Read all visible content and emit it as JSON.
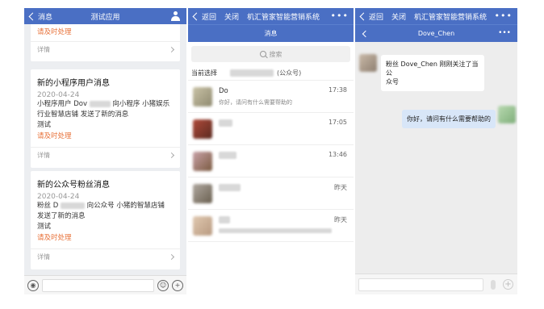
{
  "panel1": {
    "back_label": "消息",
    "title": "测试应用",
    "top_card": {
      "alert": "请及时处理",
      "detail_label": "详情"
    },
    "card1": {
      "title": "新的小程序用户消息",
      "date": "2020-04-24",
      "line1_pre": "小程序用户 Dov",
      "line1_post": "向小程序 小猪娱乐",
      "line2": "行业智慧店铺 发送了新的消息",
      "line3": "测试",
      "alert": "请及时处理",
      "detail_label": "详情"
    },
    "card2": {
      "title": "新的公众号粉丝消息",
      "date": "2020-04-24",
      "line1_pre": "粉丝 D",
      "line1_post": "向公众号 小猪的智慧店铺",
      "line2": "发送了新的消息",
      "line3": "测试",
      "alert": "请及时处理",
      "detail_label": "详情"
    }
  },
  "panel2": {
    "back_label": "返回",
    "close_label": "关闭",
    "title": "机汇管家智能营销系统",
    "more": "•••",
    "sub_title": "消息",
    "search_placeholder": "搜索",
    "current_label": "当前选择",
    "current_tag": "(公众号)",
    "conversations": [
      {
        "name": "Do",
        "msg": "你好，请问有什么需要帮助的",
        "time": "17:38"
      },
      {
        "name": "",
        "msg": "",
        "time": "17:05"
      },
      {
        "name": "",
        "msg": "",
        "time": "13:46"
      },
      {
        "name": "",
        "msg": "",
        "time": "昨天"
      },
      {
        "name": "",
        "msg": "",
        "time": "昨天"
      }
    ]
  },
  "panel3": {
    "back_label": "返回",
    "close_label": "关闭",
    "title": "机汇管家智能营销系统",
    "more": "•••",
    "chat_title": "Dove_Chen",
    "sub_more": "•••",
    "msg_in_line1": "粉丝 Dove_Chen 刚刚关注了当公",
    "msg_in_line2": "众号",
    "msg_out": "你好，请问有什么需要帮助的"
  },
  "colors": {
    "header_blue": "#4a6fc4",
    "alert_orange": "#e8723a",
    "bubble_blue": "#d8e6f8"
  }
}
